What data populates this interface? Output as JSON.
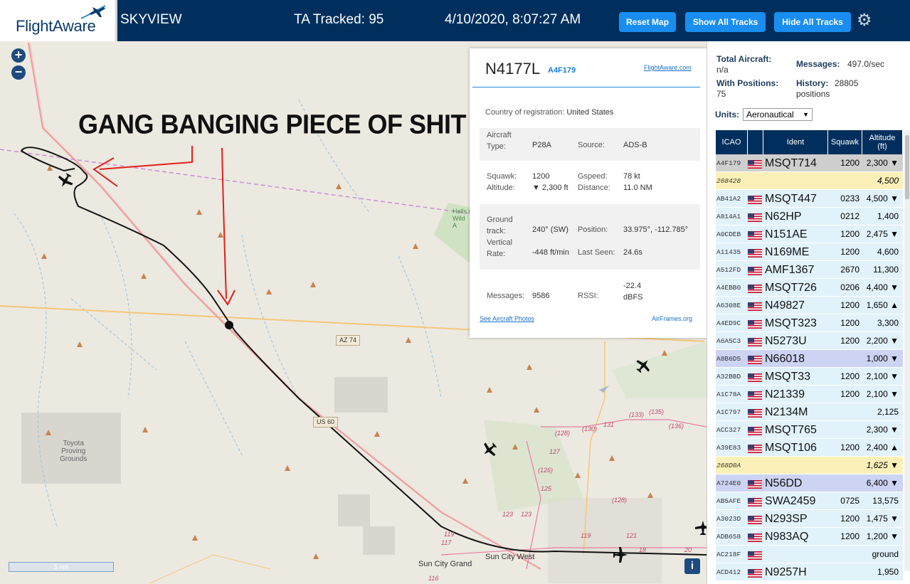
{
  "header": {
    "brand": "FlightAware",
    "app_name": "SKYVIEW",
    "ta_tracked": "TA Tracked: 95",
    "datetime": "4/10/2020, 8:07:27 AM",
    "buttons": {
      "reset_map": "Reset Map",
      "show_all_tracks": "Show All Tracks",
      "hide_all_tracks": "Hide All Tracks"
    },
    "icons": {
      "logo": "plane-logo-icon",
      "settings": "gear-icon"
    },
    "colors": {
      "bar": "#002f5d",
      "button": "#1a8ef0"
    }
  },
  "map": {
    "zoom_in": "+",
    "zoom_out": "−",
    "annotation": "GANG BANGING PIECE OF SHIT",
    "labels": {
      "toyota": "Toyota\nProving\nGrounds",
      "sun_city_west": "Sun City West",
      "sun_city_grand": "Sun City Grand",
      "hells_canyon": "Hells C\nWild\nA",
      "az74": "AZ 74",
      "us60": "US 60"
    },
    "road_numbers": [
      "(128)",
      "127",
      "(130)",
      "131",
      "(133)",
      "(135)",
      "(136)",
      "(126)",
      "125",
      "123",
      "123",
      "119",
      "117",
      "116",
      "119",
      "121",
      "18",
      "20",
      "(128)"
    ],
    "scale": "5 nm",
    "info": "i"
  },
  "popup": {
    "callsign": "N4177L",
    "hex": "A4F179",
    "fa_link": "FlightAware.com",
    "country_label": "Country of registration:",
    "country_value": "United States",
    "aircraft_type_label": "Aircraft\nType:",
    "aircraft_type_value": "P28A",
    "source_label": "Source:",
    "source_value": "ADS-B",
    "squawk_label": "Squawk:",
    "squawk_value": "1200",
    "gspeed_label": "Gspeed:",
    "gspeed_value": "78 kt",
    "altitude_label": "Altitude:",
    "altitude_value": "▼ 2,300 ft",
    "distance_label": "Distance:",
    "distance_value": "11.0 NM",
    "ground_track_label": "Ground\ntrack:",
    "ground_track_value": "240° (SW)",
    "position_label": "Position:",
    "position_value": "33.975°, -112.785°",
    "vertical_rate_label": "Vertical\nRate:",
    "vertical_rate_value": "-448 ft/min",
    "last_seen_label": "Last Seen:",
    "last_seen_value": "24.6s",
    "messages_label": "Messages:",
    "messages_value": "9586",
    "rssi_label": "RSSI:",
    "rssi_value": "-22.4\ndBFS",
    "see_photos": "See Aircraft Photos",
    "airframes": "AirFrames.org"
  },
  "sidebar": {
    "total_aircraft_label": "Total Aircraft:",
    "total_aircraft_value": "n/a",
    "with_positions_label": "With Positions:",
    "with_positions_value": "75",
    "messages_label": "Messages:",
    "messages_value": "497.0/sec",
    "history_label": "History:",
    "history_value": "28805\npositions",
    "units_label": "Units:",
    "units_value": "Aeronautical",
    "columns": [
      "ICAO",
      "",
      "Ident",
      "Squawk",
      "Altitude\n(ft)"
    ],
    "rows": [
      {
        "icao": "A4F179",
        "flag": true,
        "ident": "MSQT714",
        "squawk": "1200",
        "alt": "2,300 ▼",
        "bg": "#cfcfcf"
      },
      {
        "icao": "268428",
        "flag": false,
        "ident": "",
        "squawk": "",
        "alt": "4,500",
        "bg": "#fbf1b8",
        "y": true
      },
      {
        "icao": "AB41A2",
        "flag": true,
        "ident": "MSQT447",
        "squawk": "0233",
        "alt": "4,500 ▼",
        "bg": "#e1f2fa"
      },
      {
        "icao": "A814A1",
        "flag": true,
        "ident": "N62HP",
        "squawk": "0212",
        "alt": "1,400",
        "bg": "#e1f2fa"
      },
      {
        "icao": "A0CDEB",
        "flag": true,
        "ident": "N151AE",
        "squawk": "1200",
        "alt": "2,475 ▼",
        "bg": "#e1f2fa"
      },
      {
        "icao": "A11435",
        "flag": true,
        "ident": "N169ME",
        "squawk": "1200",
        "alt": "4,600",
        "bg": "#e1f2fa"
      },
      {
        "icao": "A512FD",
        "flag": true,
        "ident": "AMF1367",
        "squawk": "2670",
        "alt": "11,300 ▲",
        "bg": "#e1f2fa"
      },
      {
        "icao": "A4EBB0",
        "flag": true,
        "ident": "MSQT726",
        "squawk": "0206",
        "alt": "4,400 ▼",
        "bg": "#e1f2fa"
      },
      {
        "icao": "A6308E",
        "flag": true,
        "ident": "N49827",
        "squawk": "1200",
        "alt": "1,650 ▲",
        "bg": "#e1f2fa"
      },
      {
        "icao": "A4ED9C",
        "flag": true,
        "ident": "MSQT323",
        "squawk": "1200",
        "alt": "3,300",
        "bg": "#e1f2fa"
      },
      {
        "icao": "A6A5C3",
        "flag": true,
        "ident": "N5273U",
        "squawk": "1200",
        "alt": "2,200 ▼",
        "bg": "#e1f2fa"
      },
      {
        "icao": "A8B6D5",
        "flag": true,
        "ident": "N66018",
        "squawk": "",
        "alt": "1,000 ▼",
        "bg": "#cdd3f2"
      },
      {
        "icao": "A32BBD",
        "flag": true,
        "ident": "MSQT33",
        "squawk": "1200",
        "alt": "2,100 ▼",
        "bg": "#e1f2fa"
      },
      {
        "icao": "A1C78A",
        "flag": true,
        "ident": "N21339",
        "squawk": "1200",
        "alt": "2,100 ▼",
        "bg": "#e1f2fa"
      },
      {
        "icao": "A1C797",
        "flag": true,
        "ident": "N2134M",
        "squawk": "",
        "alt": "2,125",
        "bg": "#e1f2fa"
      },
      {
        "icao": "ACC327",
        "flag": true,
        "ident": "MSQT765",
        "squawk": "",
        "alt": "2,300 ▼",
        "bg": "#e1f2fa"
      },
      {
        "icao": "A39E83",
        "flag": true,
        "ident": "MSQT106",
        "squawk": "1200",
        "alt": "2,400 ▲",
        "bg": "#e1f2fa"
      },
      {
        "icao": "268D0A",
        "flag": false,
        "ident": "",
        "squawk": "",
        "alt": "1,625 ▼",
        "bg": "#fbf1b8",
        "y": true
      },
      {
        "icao": "A724E0",
        "flag": true,
        "ident": "N56DD",
        "squawk": "",
        "alt": "6,400 ▼",
        "bg": "#cdd3f2"
      },
      {
        "icao": "AB5AFE",
        "flag": true,
        "ident": "SWA2459",
        "squawk": "0725",
        "alt": "13,575 ▲",
        "bg": "#e1f2fa"
      },
      {
        "icao": "A3023D",
        "flag": true,
        "ident": "N293SP",
        "squawk": "1200",
        "alt": "1,475 ▼",
        "bg": "#e1f2fa"
      },
      {
        "icao": "ADB658",
        "flag": true,
        "ident": "N983AQ",
        "squawk": "1200",
        "alt": "1,200 ▼",
        "bg": "#e1f2fa"
      },
      {
        "icao": "AC218F",
        "flag": true,
        "ident": "",
        "squawk": "",
        "alt": "ground",
        "bg": "#e1f2fa"
      },
      {
        "icao": "ACD412",
        "flag": true,
        "ident": "N9257H",
        "squawk": "",
        "alt": "1,950",
        "bg": "#e1f2fa"
      }
    ]
  }
}
